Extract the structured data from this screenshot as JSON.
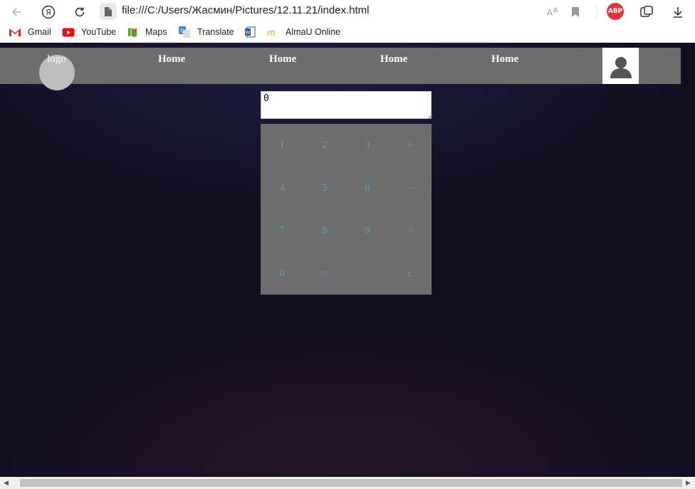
{
  "browser": {
    "url": "file:///C:/Users/Жасмин/Pictures/12.11.21/index.html",
    "abp_label": "ABP",
    "bookmarks": [
      {
        "label": "Gmail",
        "icon": "gmail-icon"
      },
      {
        "label": "YouTube",
        "icon": "youtube-icon"
      },
      {
        "label": "Maps",
        "icon": "maps-icon"
      },
      {
        "label": "Translate",
        "icon": "translate-icon"
      },
      {
        "label": "",
        "icon": "word-doc-icon"
      },
      {
        "label": "AlmaU Online",
        "icon": "almau-icon"
      }
    ]
  },
  "header": {
    "logo": "logo",
    "nav": [
      "Home",
      "Home",
      "Home",
      "Home"
    ],
    "avatar_icon": "user-avatar-icon"
  },
  "calculator": {
    "display_value": "0",
    "keys": [
      "1",
      "2",
      "3",
      "+",
      "4",
      "5",
      "6",
      "-",
      "7",
      "8",
      "9",
      "/",
      "0",
      "=",
      ".",
      "c"
    ]
  },
  "colors": {
    "header_bg": "#6d6d6d",
    "page_bg": "#120f22",
    "key_text": "#4aa3c8"
  }
}
